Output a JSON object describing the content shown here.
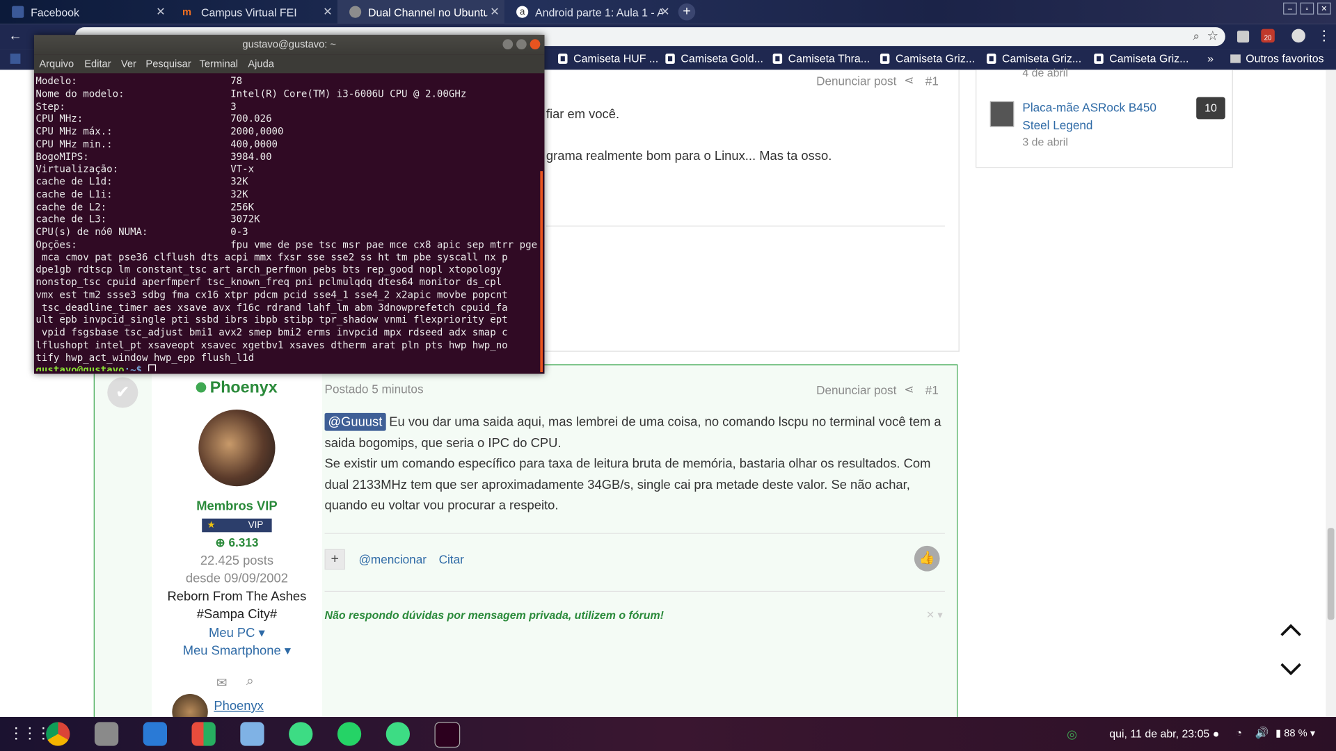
{
  "browser": {
    "tabs": [
      {
        "label": "Facebook",
        "color": "#3b5998"
      },
      {
        "label": "Campus Virtual FEI",
        "color": "#f37021"
      },
      {
        "label": "Dual Channel no Ubuntu",
        "color": "#888888"
      },
      {
        "label": "Android parte 1: Aula 1 - A",
        "color": "#ffffff"
      }
    ],
    "bookmarks": [
      "Camiseta HUF ...",
      "Camiseta Gold...",
      "Camiseta Thra...",
      "Camiseta Griz...",
      "Camiseta Griz...",
      "Camiseta Griz..."
    ],
    "bookmarks_more": "»",
    "other_favorites": "Outros favoritos",
    "ext_badge": "20"
  },
  "terminal": {
    "title": "gustavo@gustavo: ~",
    "menu": [
      "Arquivo",
      "Editar",
      "Ver",
      "Pesquisar",
      "Terminal",
      "Ajuda"
    ],
    "output": "Modelo:                          78\nNome do modelo:                  Intel(R) Core(TM) i3-6006U CPU @ 2.00GHz\nStep:                            3\nCPU MHz:                         700.026\nCPU MHz máx.:                    2000,0000\nCPU MHz min.:                    400,0000\nBogoMIPS:                        3984.00\nVirtualização:                   VT-x\ncache de L1d:                    32K\ncache de L1i:                    32K\ncache de L2:                     256K\ncache de L3:                     3072K\nCPU(s) de nó0 NUMA:              0-3\nOpções:                          fpu vme de pse tsc msr pae mce cx8 apic sep mtrr pge\n mca cmov pat pse36 clflush dts acpi mmx fxsr sse sse2 ss ht tm pbe syscall nx p\ndpe1gb rdtscp lm constant_tsc art arch_perfmon pebs bts rep_good nopl xtopology\nnonstop_tsc cpuid aperfmperf tsc_known_freq pni pclmulqdq dtes64 monitor ds_cpl\nvmx est tm2 ssse3 sdbg fma cx16 xtpr pdcm pcid sse4_1 sse4_2 x2apic movbe popcnt\n tsc_deadline_timer aes xsave avx f16c rdrand lahf_lm abm 3dnowprefetch cpuid_fa\nult epb invpcid_single pti ssbd ibrs ibpb stibp tpr_shadow vnmi flexpriority ept\n vpid fsgsbase tsc_adjust bmi1 avx2 smep bmi2 erms invpcid mpx rdseed adx smap c\nlflushopt intel_pt xsaveopt xsavec xgetbv1 xsaves dtherm arat pln pts hwp hwp_no\ntify hwp_act_window hwp_epp flush_l1d",
    "prompt_user": "gustavo@gustavo",
    "prompt_rest": ":~$ "
  },
  "post1": {
    "report": "Denunciar post",
    "number": "#1",
    "line1": "fiar em você.",
    "line2": "grama realmente bom para o Linux... Mas ta osso."
  },
  "sidebar": {
    "prev_date": "4 de abril",
    "item_title": "Placa-mãe ASRock B450 Steel Legend",
    "item_count": "10",
    "item_date": "3 de abril"
  },
  "post2": {
    "author": "Phoenyx",
    "posted": "Postado 5 minutos",
    "report": "Denunciar post",
    "number": "#1",
    "group": "Membros VIP",
    "vip": "VIP",
    "reputation": "6.313",
    "posts": "22.425 posts",
    "since": "desde 09/09/2002",
    "title1": "Reborn From The Ashes",
    "title2": "#Sampa City#",
    "meu_pc": "Meu PC",
    "meu_smartphone": "Meu Smartphone",
    "mention_tag": "@Guuust",
    "text1": " Eu vou dar uma saida aqui, mas lembrei de uma coisa, no comando lscpu no terminal você tem a saida bogomips, que seria o IPC do CPU.",
    "text2": "Se existir um comando específico para taxa de leitura bruta de memória, bastaria olhar os resultados. Com dual 2133MHz tem que ser aproximadamente 34GB/s, single cai pra metade deste valor.  Se não achar, quando eu voltar vou procurar a respeito.",
    "mention": "@mencionar",
    "quote": "Citar",
    "signature": "Não respondo dúvidas por mensagem privada, utilizem o fórum!",
    "mini_author": "Phoenyx"
  },
  "taskbar": {
    "datetime": "qui, 11 de abr, 23:05",
    "battery": "88 %"
  }
}
